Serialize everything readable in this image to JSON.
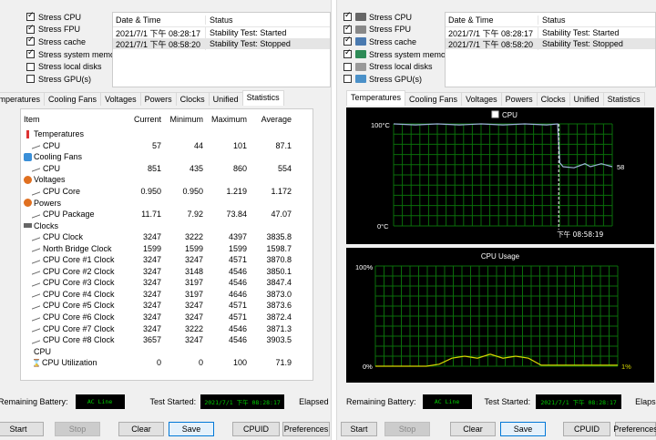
{
  "stress_options": [
    {
      "label": "Stress CPU",
      "checked": true,
      "icon": "cpu-icon"
    },
    {
      "label": "Stress FPU",
      "checked": true,
      "icon": "fpu-icon"
    },
    {
      "label": "Stress cache",
      "checked": true,
      "icon": "cache-icon"
    },
    {
      "label": "Stress system memory",
      "checked": true,
      "icon": "memory-icon"
    },
    {
      "label": "Stress local disks",
      "checked": false,
      "icon": "disk-icon"
    },
    {
      "label": "Stress GPU(s)",
      "checked": false,
      "icon": "gpu-icon"
    }
  ],
  "log": {
    "col_datetime": "Date & Time",
    "col_status": "Status",
    "rows": [
      {
        "datetime": "2021/7/1 下午 08:28:17",
        "status": "Stability Test: Started"
      },
      {
        "datetime": "2021/7/1 下午 08:58:20",
        "status": "Stability Test: Stopped"
      }
    ]
  },
  "left_tabs": [
    "Temperatures",
    "Cooling Fans",
    "Voltages",
    "Powers",
    "Clocks",
    "Unified",
    "Statistics"
  ],
  "right_tabs": [
    "Temperatures",
    "Cooling Fans",
    "Voltages",
    "Powers",
    "Clocks",
    "Unified",
    "Statistics"
  ],
  "stats": {
    "headers": {
      "item": "Item",
      "current": "Current",
      "minimum": "Minimum",
      "maximum": "Maximum",
      "average": "Average"
    },
    "rows": [
      {
        "type": "group",
        "name": "Temperatures",
        "icon": "thermometer-icon"
      },
      {
        "type": "item",
        "name": "CPU",
        "cur": "57",
        "min": "44",
        "max": "101",
        "avg": "87.1"
      },
      {
        "type": "group",
        "name": "Cooling Fans",
        "icon": "fan-icon"
      },
      {
        "type": "item",
        "name": "CPU",
        "cur": "851",
        "min": "435",
        "max": "860",
        "avg": "554"
      },
      {
        "type": "group",
        "name": "Voltages",
        "icon": "voltage-icon"
      },
      {
        "type": "item",
        "name": "CPU Core",
        "cur": "0.950",
        "min": "0.950",
        "max": "1.219",
        "avg": "1.172"
      },
      {
        "type": "group",
        "name": "Powers",
        "icon": "power-icon"
      },
      {
        "type": "item",
        "name": "CPU Package",
        "cur": "11.71",
        "min": "7.92",
        "max": "73.84",
        "avg": "47.07"
      },
      {
        "type": "group",
        "name": "Clocks",
        "icon": "clock-icon"
      },
      {
        "type": "item",
        "name": "CPU Clock",
        "cur": "3247",
        "min": "3222",
        "max": "4397",
        "avg": "3835.8"
      },
      {
        "type": "item",
        "name": "North Bridge Clock",
        "cur": "1599",
        "min": "1599",
        "max": "1599",
        "avg": "1598.7"
      },
      {
        "type": "item",
        "name": "CPU Core #1 Clock",
        "cur": "3247",
        "min": "3247",
        "max": "4571",
        "avg": "3870.8"
      },
      {
        "type": "item",
        "name": "CPU Core #2 Clock",
        "cur": "3247",
        "min": "3148",
        "max": "4546",
        "avg": "3850.1"
      },
      {
        "type": "item",
        "name": "CPU Core #3 Clock",
        "cur": "3247",
        "min": "3197",
        "max": "4546",
        "avg": "3847.4"
      },
      {
        "type": "item",
        "name": "CPU Core #4 Clock",
        "cur": "3247",
        "min": "3197",
        "max": "4646",
        "avg": "3873.0"
      },
      {
        "type": "item",
        "name": "CPU Core #5 Clock",
        "cur": "3247",
        "min": "3247",
        "max": "4571",
        "avg": "3873.6"
      },
      {
        "type": "item",
        "name": "CPU Core #6 Clock",
        "cur": "3247",
        "min": "3247",
        "max": "4571",
        "avg": "3872.4"
      },
      {
        "type": "item",
        "name": "CPU Core #7 Clock",
        "cur": "3247",
        "min": "3222",
        "max": "4546",
        "avg": "3871.3"
      },
      {
        "type": "item",
        "name": "CPU Core #8 Clock",
        "cur": "3657",
        "min": "3247",
        "max": "4546",
        "avg": "3903.5"
      },
      {
        "type": "group",
        "name": "CPU",
        "icon": "cpu-group-icon"
      },
      {
        "type": "item",
        "name": "CPU Utilization",
        "cur": "0",
        "min": "0",
        "max": "100",
        "avg": "71.9",
        "icon": "hourglass-icon"
      }
    ]
  },
  "status_bar": {
    "battery_label": "Remaining Battery:",
    "battery_value": "AC Line",
    "test_started_label": "Test Started:",
    "test_started_value": "2021/7/1 下午 08:28:17",
    "elapsed_label": "Elapsed Ti"
  },
  "buttons": {
    "start": "Start",
    "stop": "Stop",
    "clear": "Clear",
    "save": "Save",
    "cpuid": "CPUID",
    "preferences": "Preferences"
  },
  "temp_graph": {
    "legend": "CPU",
    "y_max_label": "100°C",
    "y_min_label": "0°C",
    "current_value": "58",
    "marker_time": "下午 08:58:19",
    "y_range": [
      0,
      100
    ],
    "series_color": "#9ab3d6",
    "grid_color": "#0a6e0a"
  },
  "usage_graph": {
    "title": "CPU Usage",
    "y_max_label": "100%",
    "y_min_label": "0%",
    "current_value": "1%",
    "y_range": [
      0,
      100
    ],
    "series_color": "#d8d800",
    "grid_color": "#0a6e0a"
  },
  "chart_data": [
    {
      "type": "line",
      "title": "CPU",
      "ylim": [
        0,
        100
      ],
      "series": [
        {
          "name": "CPU",
          "x": [
            0,
            4,
            8,
            12,
            16,
            20,
            24,
            28,
            30,
            30.4,
            31,
            33,
            35,
            36,
            38,
            40
          ],
          "values": [
            100,
            99,
            100,
            99,
            100,
            99,
            100,
            99,
            100,
            62,
            58,
            57,
            61,
            58,
            61,
            58
          ]
        }
      ]
    },
    {
      "type": "line",
      "title": "CPU Usage",
      "ylim": [
        0,
        100
      ],
      "series": [
        {
          "values": [
            0,
            0,
            0,
            0,
            0,
            2,
            8,
            10,
            8,
            12,
            8,
            10,
            8,
            1,
            1,
            1,
            1,
            1,
            1,
            1
          ]
        }
      ]
    }
  ]
}
